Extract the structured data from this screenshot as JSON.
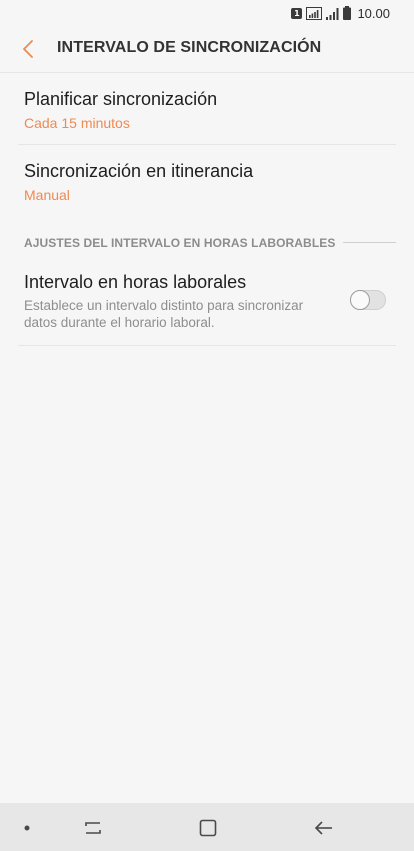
{
  "status_bar": {
    "sim_badge": "1",
    "time": "10.00",
    "icons": [
      "sim-1-icon",
      "signal-icon",
      "signal-bars-icon",
      "battery-icon"
    ]
  },
  "header": {
    "back_icon": "chevron-left-icon",
    "title": "INTERVALO DE SINCRONIZACIÓN"
  },
  "settings": {
    "schedule": {
      "title": "Planificar sincronización",
      "value": "Cada 15 minutos"
    },
    "roaming": {
      "title": "Sincronización en itinerancia",
      "value": "Manual"
    },
    "section_header": "AJUSTES DEL INTERVALO EN HORAS LABORABLES",
    "work_hours": {
      "title": "Intervalo en horas laborales",
      "description": "Establece un intervalo distinto para sincronizar datos durante el horario laboral.",
      "toggle_on": false
    }
  },
  "nav_bar": {
    "items": [
      "dot-icon",
      "recent-apps-icon",
      "home-icon",
      "back-arrow-icon"
    ]
  },
  "colors": {
    "accent": "#ef8a52",
    "background": "#f6f6f6",
    "nav_background": "#e7e7e7"
  }
}
